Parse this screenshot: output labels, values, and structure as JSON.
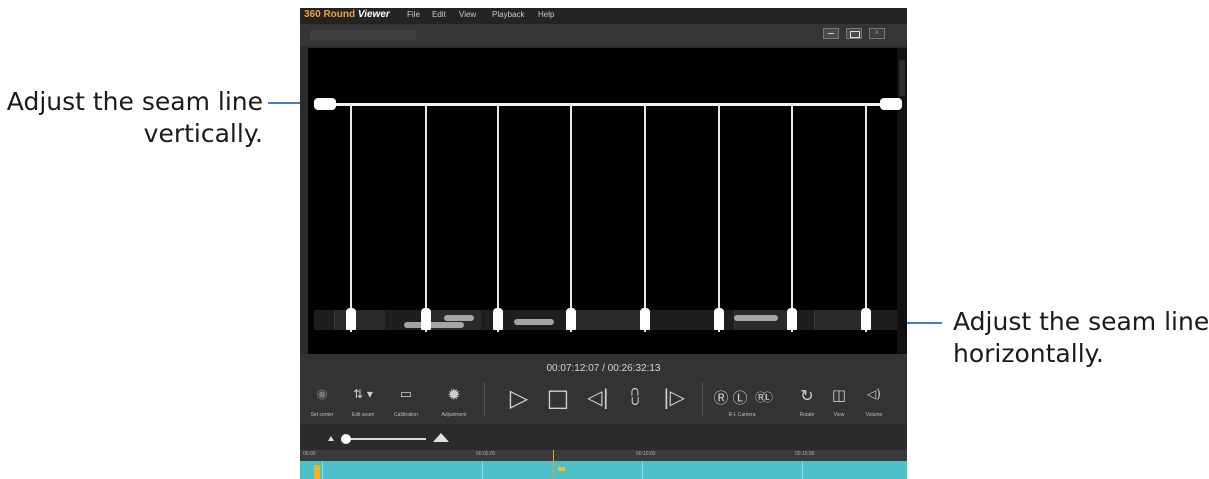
{
  "callouts": {
    "left": {
      "line1": "Adjust the seam line",
      "line2": "vertically."
    },
    "right": {
      "line1": "Adjust the seam line",
      "line2": "horizontally."
    }
  },
  "app": {
    "brand_part1": "360 Round",
    "brand_part2": "Viewer",
    "menu": [
      "File",
      "Edit",
      "View",
      "Playback",
      "Help"
    ],
    "window_buttons": [
      "minimize",
      "restore",
      "close"
    ]
  },
  "player": {
    "timecode": "00:07:12:07 / 00:26:32:13",
    "toolbar": {
      "set_center": "Set center",
      "edit_seam": "Edit seam",
      "calibration": "Calibration",
      "adjustment": "Adjustment",
      "r_l_camera": "R-L Camera",
      "rotate": "Rotate",
      "view": "View",
      "volume": "Volume"
    },
    "glyphs": {
      "set_center": "◉",
      "edit_seam": "⇅ ▾",
      "calibration": "▭",
      "adjustment": "✹",
      "play": "▷",
      "stop": "□",
      "prev_frame": "◁|",
      "marker": "⩇",
      "next_frame": "|▷",
      "cam_r": "Ⓡ",
      "cam_l": "Ⓛ",
      "cam_rl": "ⓇⓁ",
      "rotate": "↻",
      "view": "◫",
      "volume": "◁)"
    }
  },
  "timeline": {
    "ruler_labels": [
      "00:00",
      "00:05:00",
      "00:10:00",
      "00:15:00"
    ]
  },
  "colors": {
    "brand_orange": "#f0a02e",
    "timeline_teal": "#4cc0c8",
    "leader_blue": "#3a7fd0"
  }
}
